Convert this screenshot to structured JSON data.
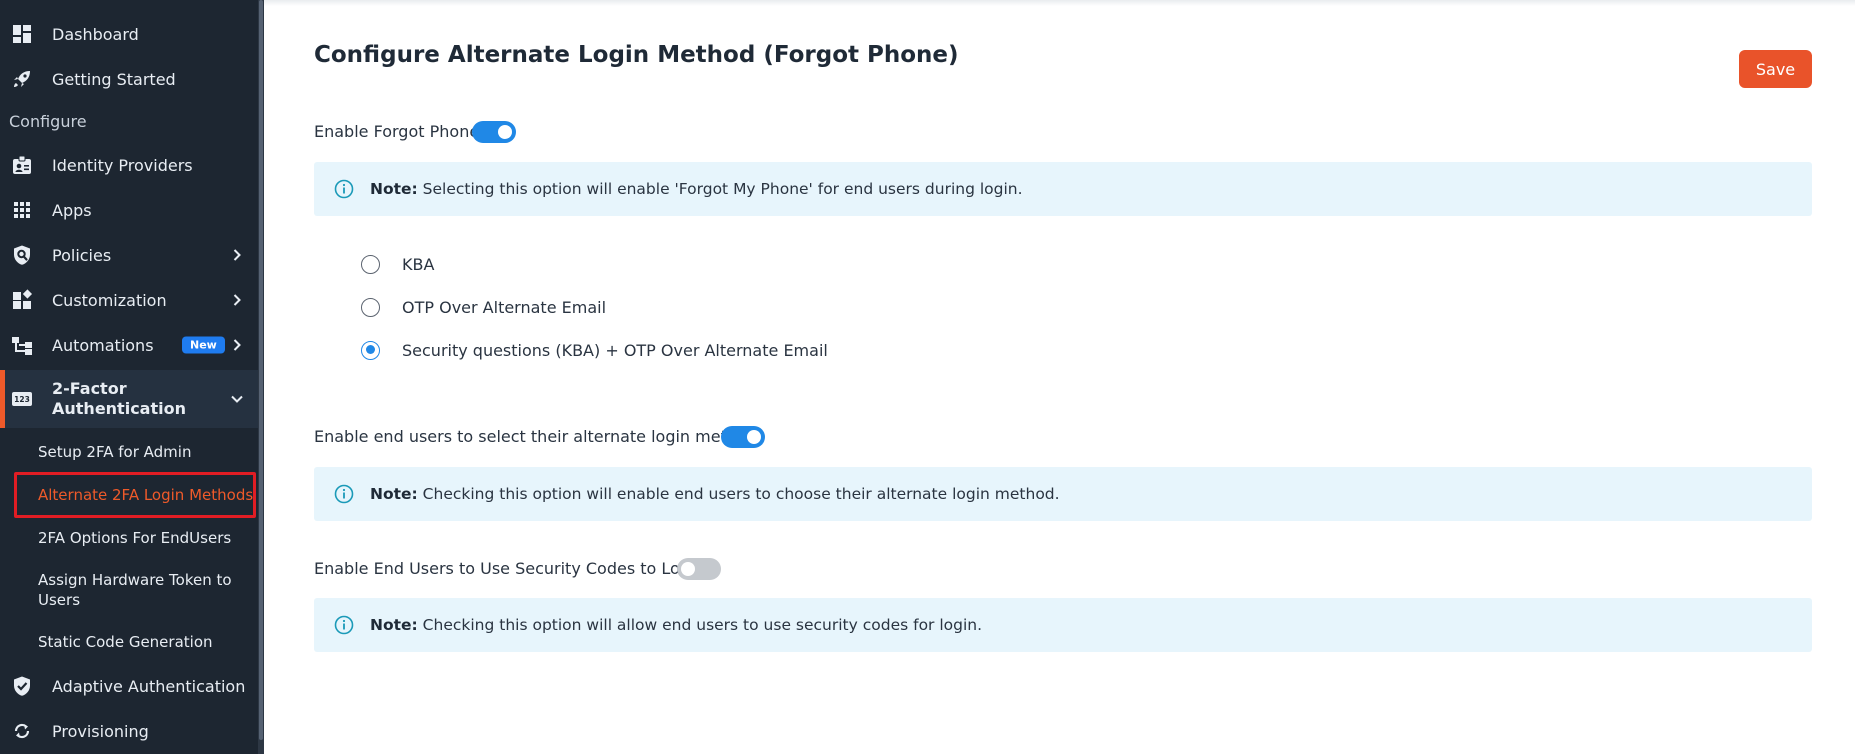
{
  "sidebar": {
    "items": [
      {
        "label": "Dashboard",
        "icon": "dashboard-icon"
      },
      {
        "label": "Getting Started",
        "icon": "rocket-icon"
      },
      {
        "label": "Identity Providers",
        "icon": "id-card-icon"
      },
      {
        "label": "Apps",
        "icon": "grid-icon"
      },
      {
        "label": "Policies",
        "icon": "shield-search-icon"
      },
      {
        "label": "Customization",
        "icon": "widgets-icon"
      },
      {
        "label": "Automations",
        "icon": "workflow-icon",
        "badge": "New"
      },
      {
        "label": "2-Factor Authentication",
        "icon": "numeric-123-icon"
      },
      {
        "label": "Adaptive Authentication",
        "icon": "shield-check-icon"
      },
      {
        "label": "Provisioning",
        "icon": "sync-icon"
      }
    ],
    "section_configure": "Configure",
    "twofa_subitems": [
      {
        "label": "Setup 2FA for Admin"
      },
      {
        "label": "Alternate 2FA Login Methods"
      },
      {
        "label": "2FA Options For EndUsers"
      },
      {
        "label": "Assign Hardware Token to Users"
      },
      {
        "label": "Static Code Generation"
      }
    ]
  },
  "main": {
    "title": "Configure Alternate Login Method (Forgot Phone)",
    "save_label": "Save",
    "forgot_phone": {
      "label": "Enable Forgot Phone",
      "enabled": true,
      "note_prefix": "Note:",
      "note_text": " Selecting this option will enable 'Forgot My Phone' for end users during login."
    },
    "methods": [
      {
        "label": "KBA",
        "selected": false
      },
      {
        "label": "OTP Over Alternate Email",
        "selected": false
      },
      {
        "label": "Security questions (KBA) + OTP Over Alternate Email",
        "selected": true
      }
    ],
    "select_method": {
      "label": "Enable end users to select their alternate login method",
      "enabled": true,
      "note_prefix": "Note:",
      "note_text": " Checking this option will enable end users to choose their alternate login method."
    },
    "security_codes": {
      "label": "Enable End Users to Use Security Codes to Login",
      "enabled": false,
      "note_prefix": "Note:",
      "note_text": " Checking this option will allow end users to use security codes for login."
    }
  },
  "colors": {
    "accent": "#e9532a",
    "toggle_on": "#2088e6",
    "sidebar_bg": "#1d2631",
    "note_bg": "#e7f5fc",
    "highlight_border": "#e11d24"
  }
}
